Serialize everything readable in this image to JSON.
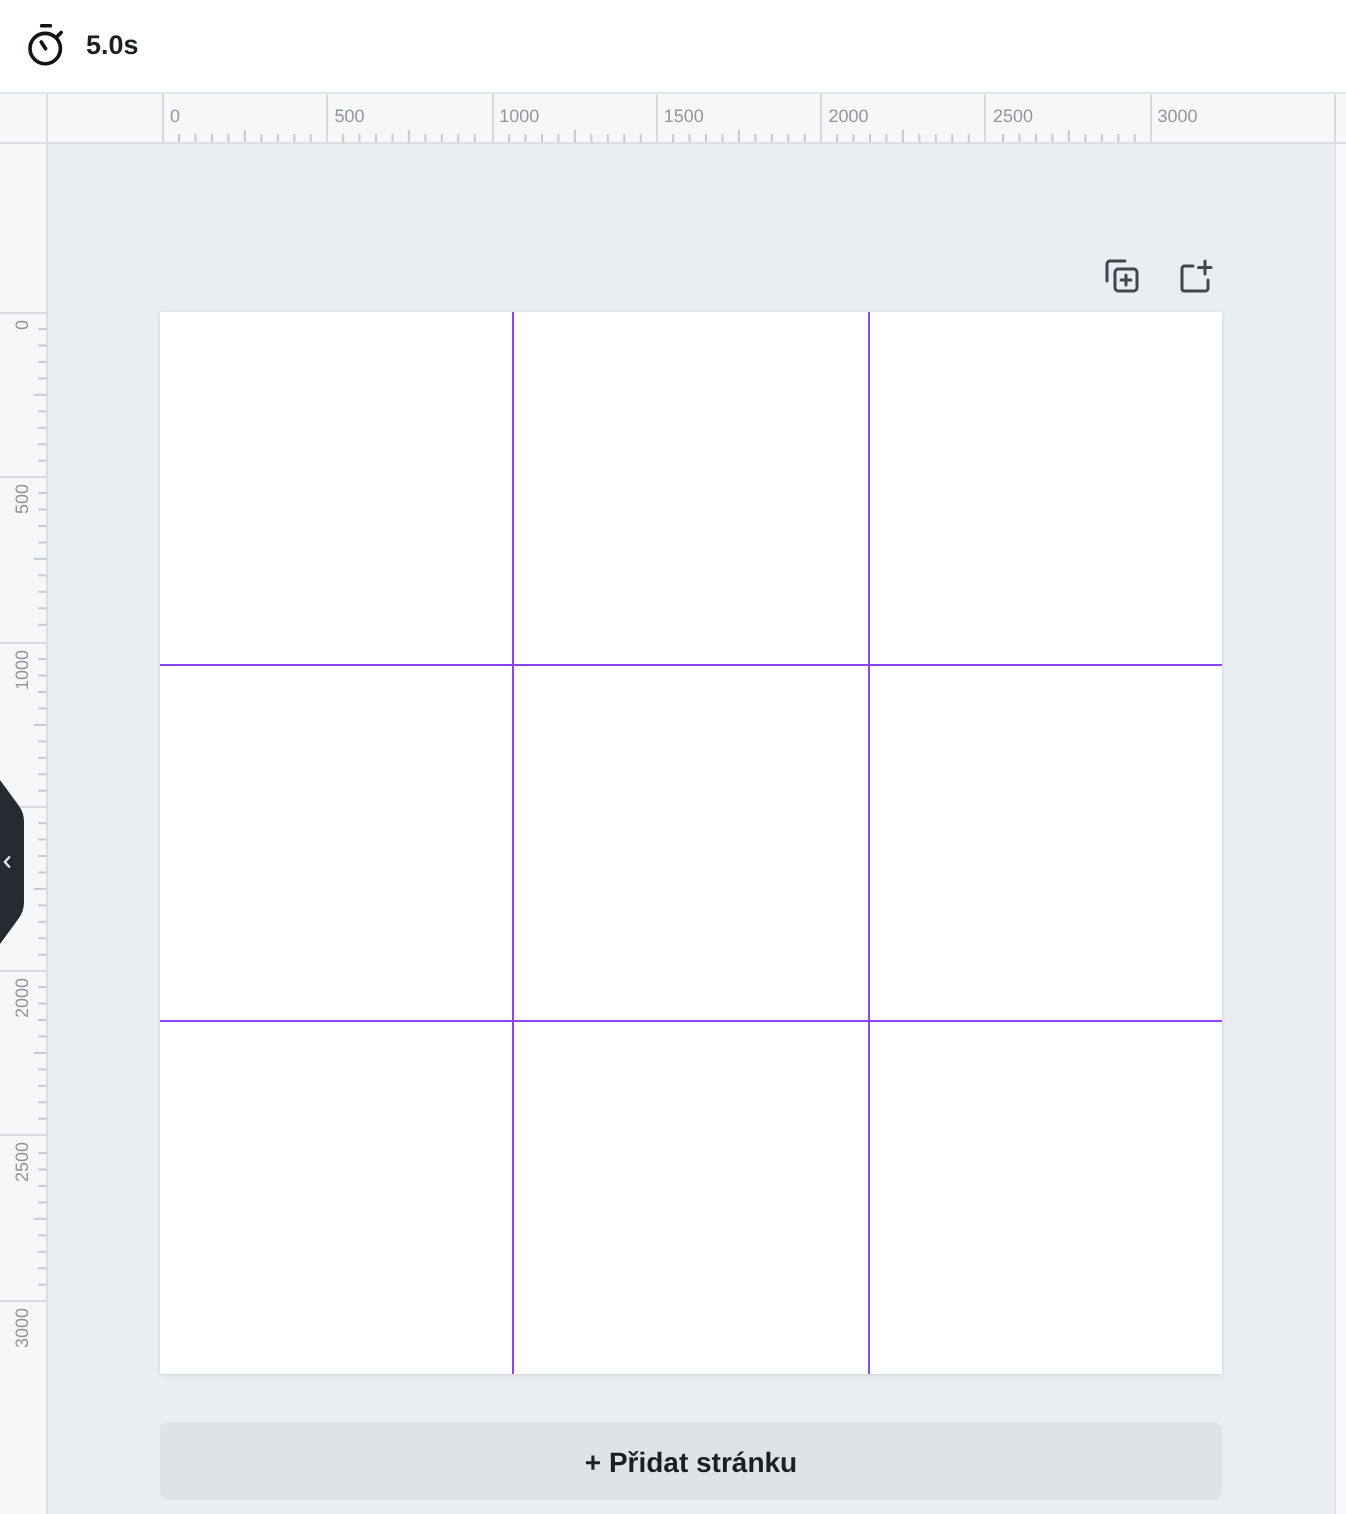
{
  "toolbar": {
    "duration": "5.0s"
  },
  "rulers": {
    "horizontal": [
      "0",
      "500",
      "1000",
      "1500",
      "2000",
      "2500",
      "3000"
    ],
    "vertical": {
      "above_handle": [
        "0",
        "500",
        "1000"
      ],
      "below_handle": [
        "2000",
        "2500",
        "3000"
      ]
    }
  },
  "page": {
    "guides_shown": true
  },
  "add_page_button": {
    "label": "+ Přidat stránku"
  }
}
